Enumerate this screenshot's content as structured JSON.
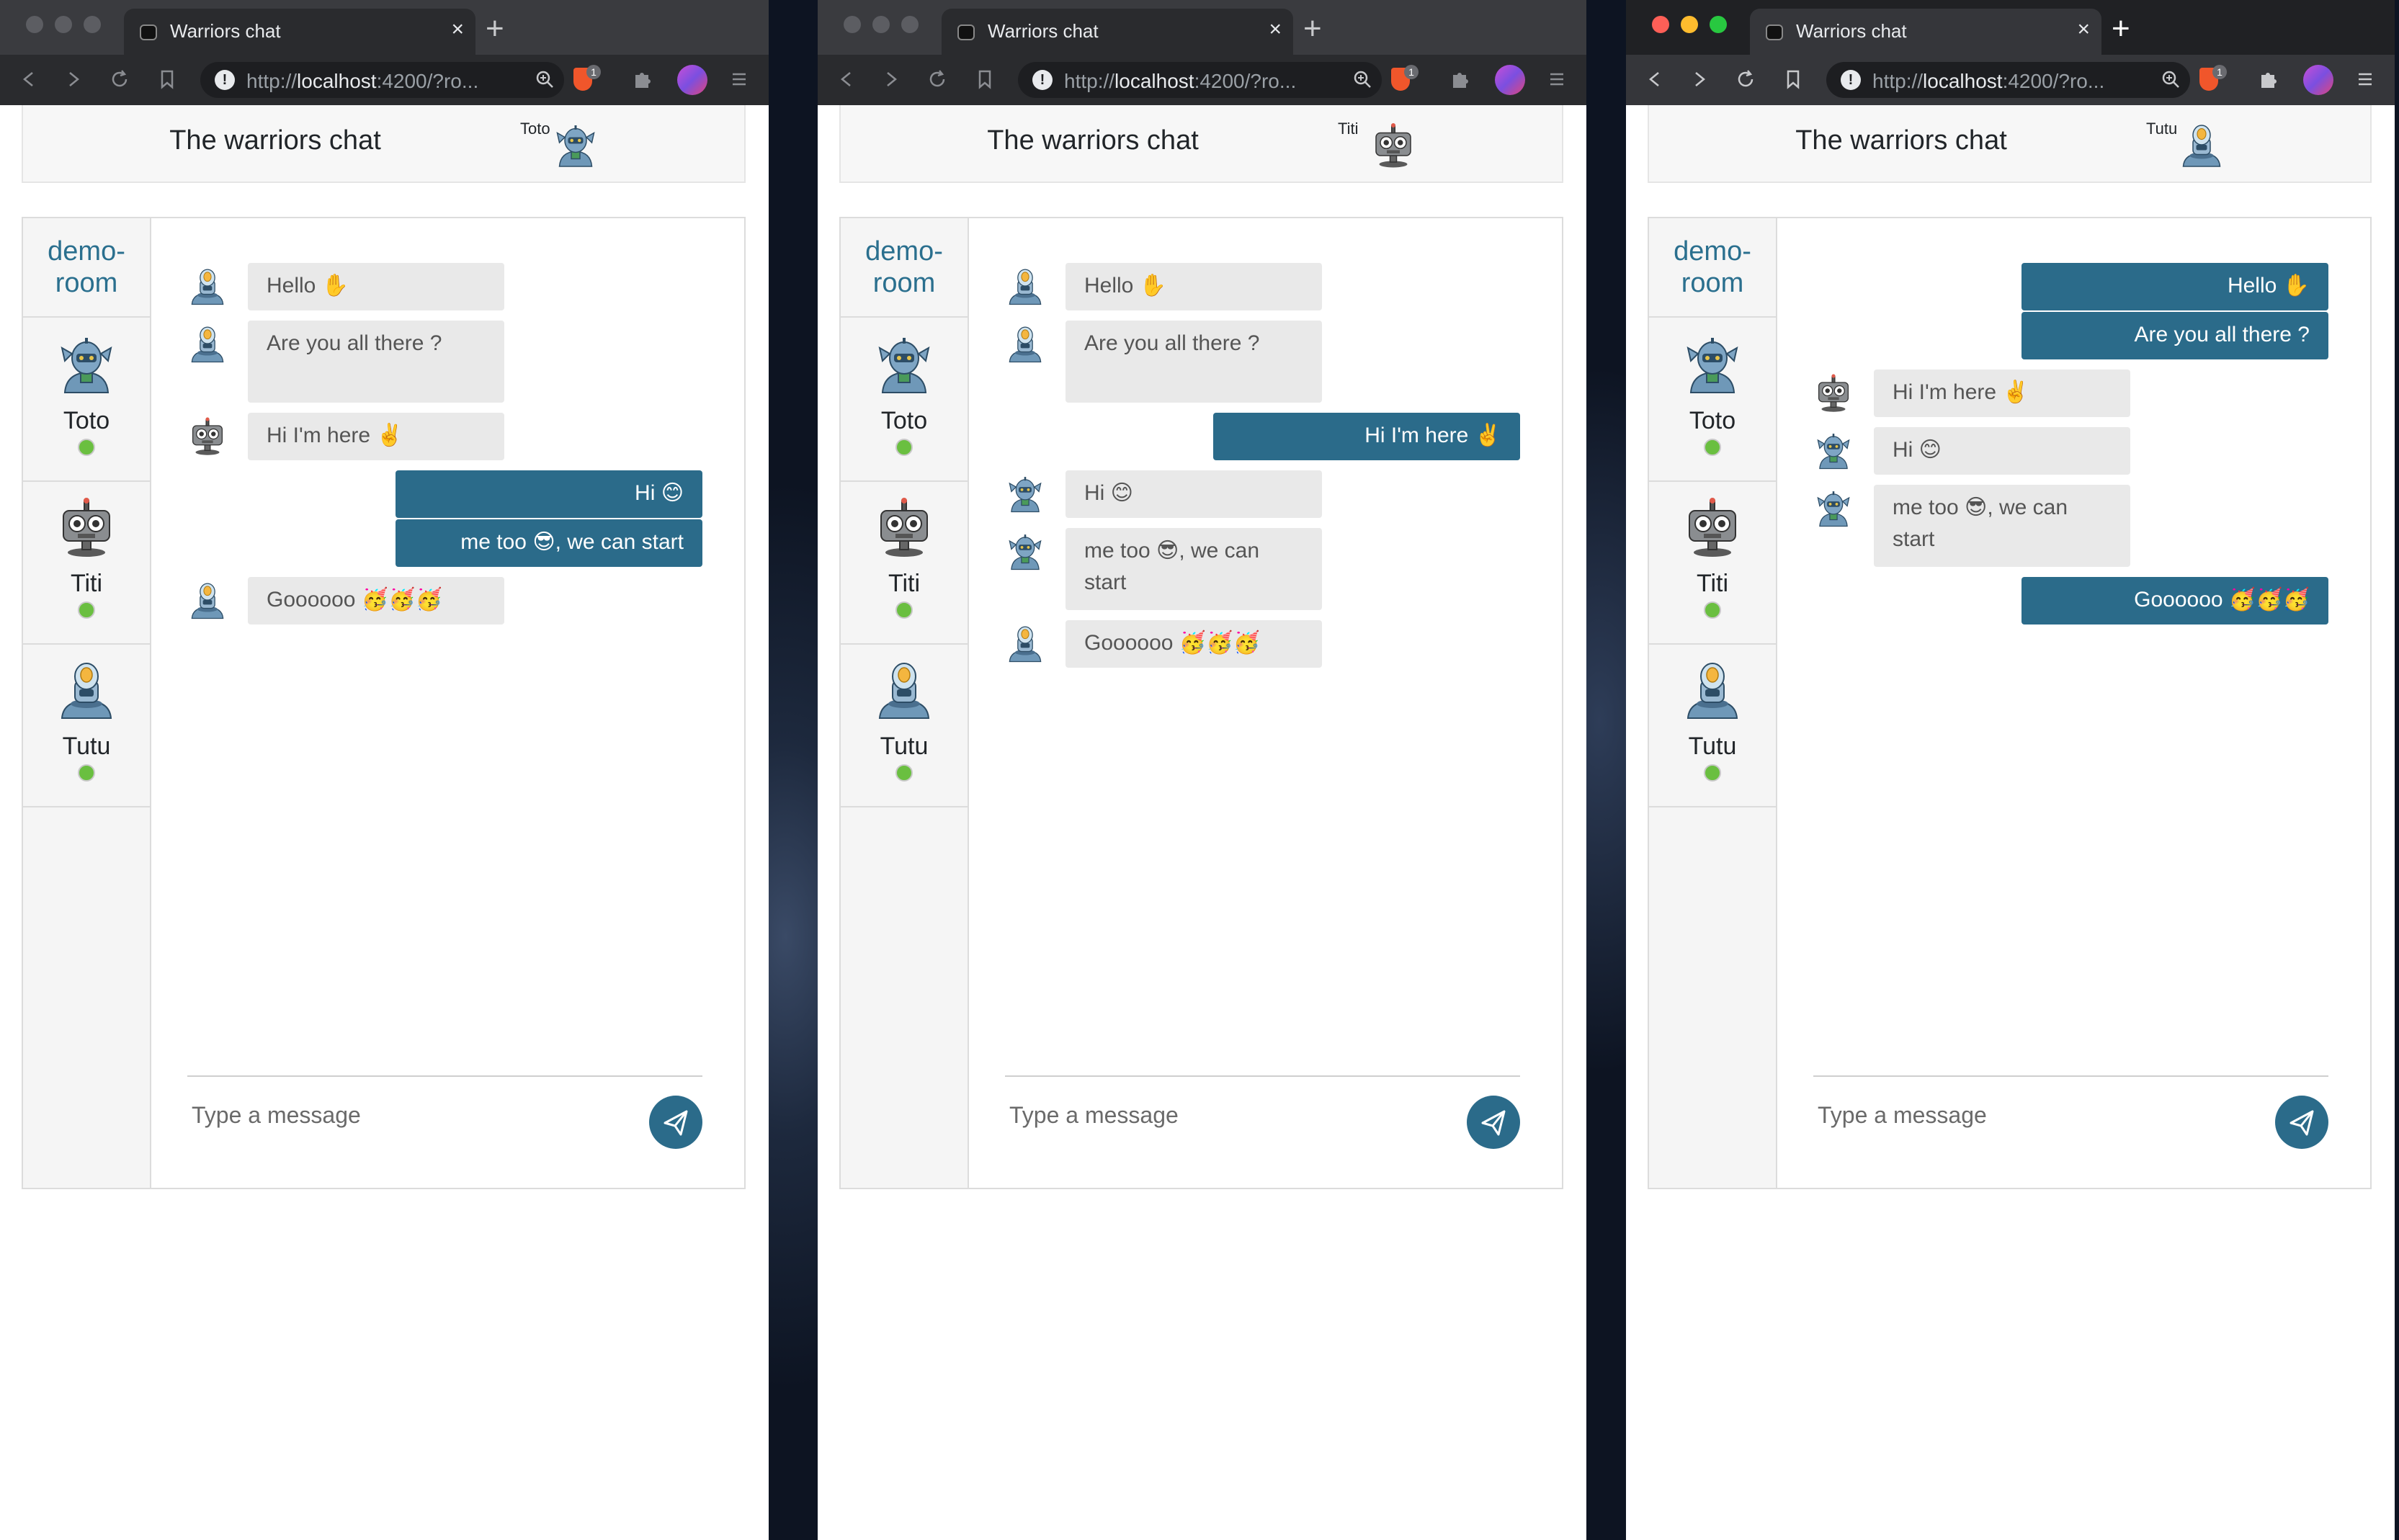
{
  "browser": {
    "tab_title": "Warriors chat",
    "tab_close": "×",
    "new_tab": "+",
    "url_prefix": "http://",
    "url_host": "localhost",
    "url_suffix": ":4200/?ro...",
    "brave_badge": "1",
    "icons": [
      "back-icon",
      "forward-icon",
      "reload-icon",
      "bookmark-icon",
      "info-icon",
      "zoom-icon",
      "brave-shield-icon",
      "extensions-icon",
      "profile-avatar",
      "menu-icon"
    ]
  },
  "app": {
    "title": "The warriors chat",
    "room": "demo-\nroom",
    "members": [
      {
        "name": "Toto",
        "avatar": "robot-toto-icon",
        "online": true
      },
      {
        "name": "Titi",
        "avatar": "robot-titi-icon",
        "online": true
      },
      {
        "name": "Tutu",
        "avatar": "robot-tutu-icon",
        "online": true
      }
    ],
    "composer_placeholder": "Type a message",
    "send_icon": "paper-plane-icon"
  },
  "windows": [
    {
      "current_user": "Toto",
      "messages": [
        {
          "from": "Tutu",
          "direction": "in",
          "text": "Hello ✋"
        },
        {
          "from": "Tutu",
          "direction": "in",
          "text": "Are you all there ?"
        },
        {
          "from": "Titi",
          "direction": "in",
          "text": "Hi I'm here ✌️"
        },
        {
          "from": "Toto",
          "direction": "out",
          "text": "Hi 😊"
        },
        {
          "from": "Toto",
          "direction": "out",
          "text": "me too 😎, we can start"
        },
        {
          "from": "Tutu",
          "direction": "in",
          "text": "Goooooo 🥳🥳🥳"
        }
      ]
    },
    {
      "current_user": "Titi",
      "messages": [
        {
          "from": "Tutu",
          "direction": "in",
          "text": "Hello ✋"
        },
        {
          "from": "Tutu",
          "direction": "in",
          "text": "Are you all there ?"
        },
        {
          "from": "Titi",
          "direction": "out",
          "text": "Hi I'm here ✌️"
        },
        {
          "from": "Toto",
          "direction": "in",
          "text": "Hi 😊"
        },
        {
          "from": "Toto",
          "direction": "in",
          "text": "me too 😎, we can start"
        },
        {
          "from": "Tutu",
          "direction": "in",
          "text": "Goooooo 🥳🥳🥳"
        }
      ]
    },
    {
      "current_user": "Tutu",
      "messages": [
        {
          "from": "Tutu",
          "direction": "out",
          "text": "Hello ✋"
        },
        {
          "from": "Tutu",
          "direction": "out",
          "text": "Are you all there ?"
        },
        {
          "from": "Titi",
          "direction": "in",
          "text": "Hi I'm here ✌️"
        },
        {
          "from": "Toto",
          "direction": "in",
          "text": "Hi 😊"
        },
        {
          "from": "Toto",
          "direction": "in",
          "text": "me too 😎, we can start"
        },
        {
          "from": "Tutu",
          "direction": "out",
          "text": "Goooooo 🥳🥳🥳"
        }
      ]
    }
  ],
  "colors": {
    "accent": "#2b6b8a",
    "room_link": "#2a6f8e",
    "incoming_bubble": "#e9e9e9",
    "online_dot": "#6abf40",
    "brave_orange": "#f0562b"
  }
}
